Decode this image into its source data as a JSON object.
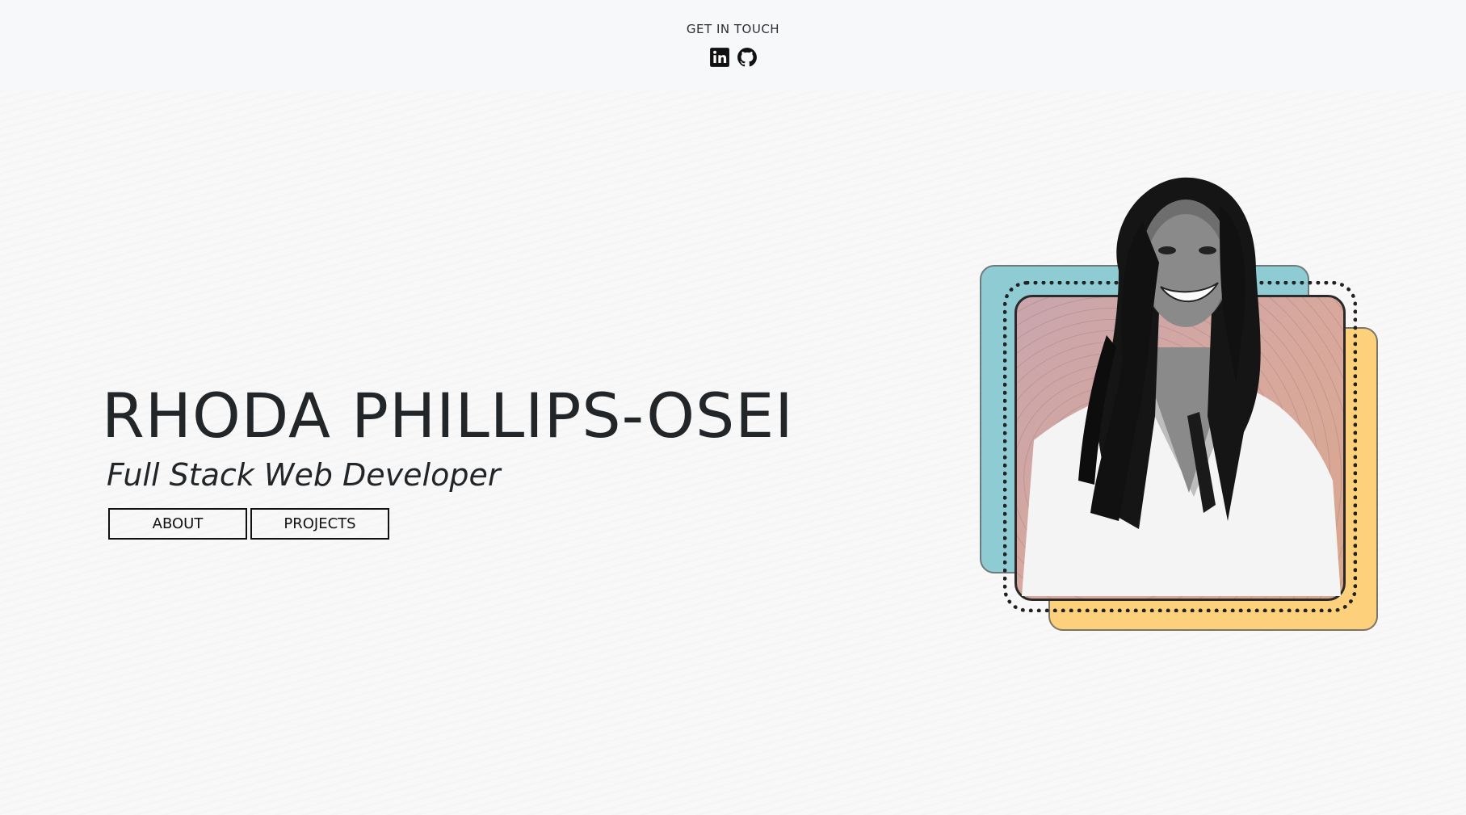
{
  "header": {
    "contact_label": "GET IN TOUCH",
    "social_icons": [
      "linkedin-icon",
      "github-icon"
    ]
  },
  "hero": {
    "name": "RHODA PHILLIPS-OSEI",
    "role": "Full Stack Web Developer",
    "buttons": {
      "about_label": "ABOUT",
      "projects_label": "PROJECTS"
    }
  },
  "portrait": {
    "accent_colors": {
      "teal": "#8fcbd3",
      "yellow": "#fdd07c",
      "pink": "#c9a5ad"
    }
  }
}
